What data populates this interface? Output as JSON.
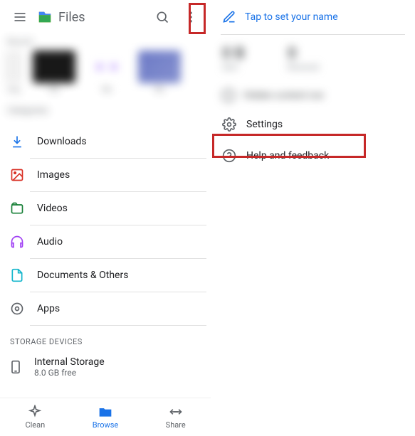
{
  "app": {
    "title": "Files"
  },
  "categories": [
    {
      "id": "downloads",
      "label": "Downloads"
    },
    {
      "id": "images",
      "label": "Images"
    },
    {
      "id": "videos",
      "label": "Videos"
    },
    {
      "id": "audio",
      "label": "Audio"
    },
    {
      "id": "documents",
      "label": "Documents & Others"
    },
    {
      "id": "apps",
      "label": "Apps"
    }
  ],
  "storage": {
    "section_label": "STORAGE DEVICES",
    "internal": {
      "title": "Internal Storage",
      "subtitle": "8.0 GB free"
    }
  },
  "bottom_nav": {
    "clean": "Clean",
    "browse": "Browse",
    "share": "Share"
  },
  "right": {
    "prompt": "Tap to set your name",
    "settings": "Settings",
    "help": "Help and feedback"
  }
}
